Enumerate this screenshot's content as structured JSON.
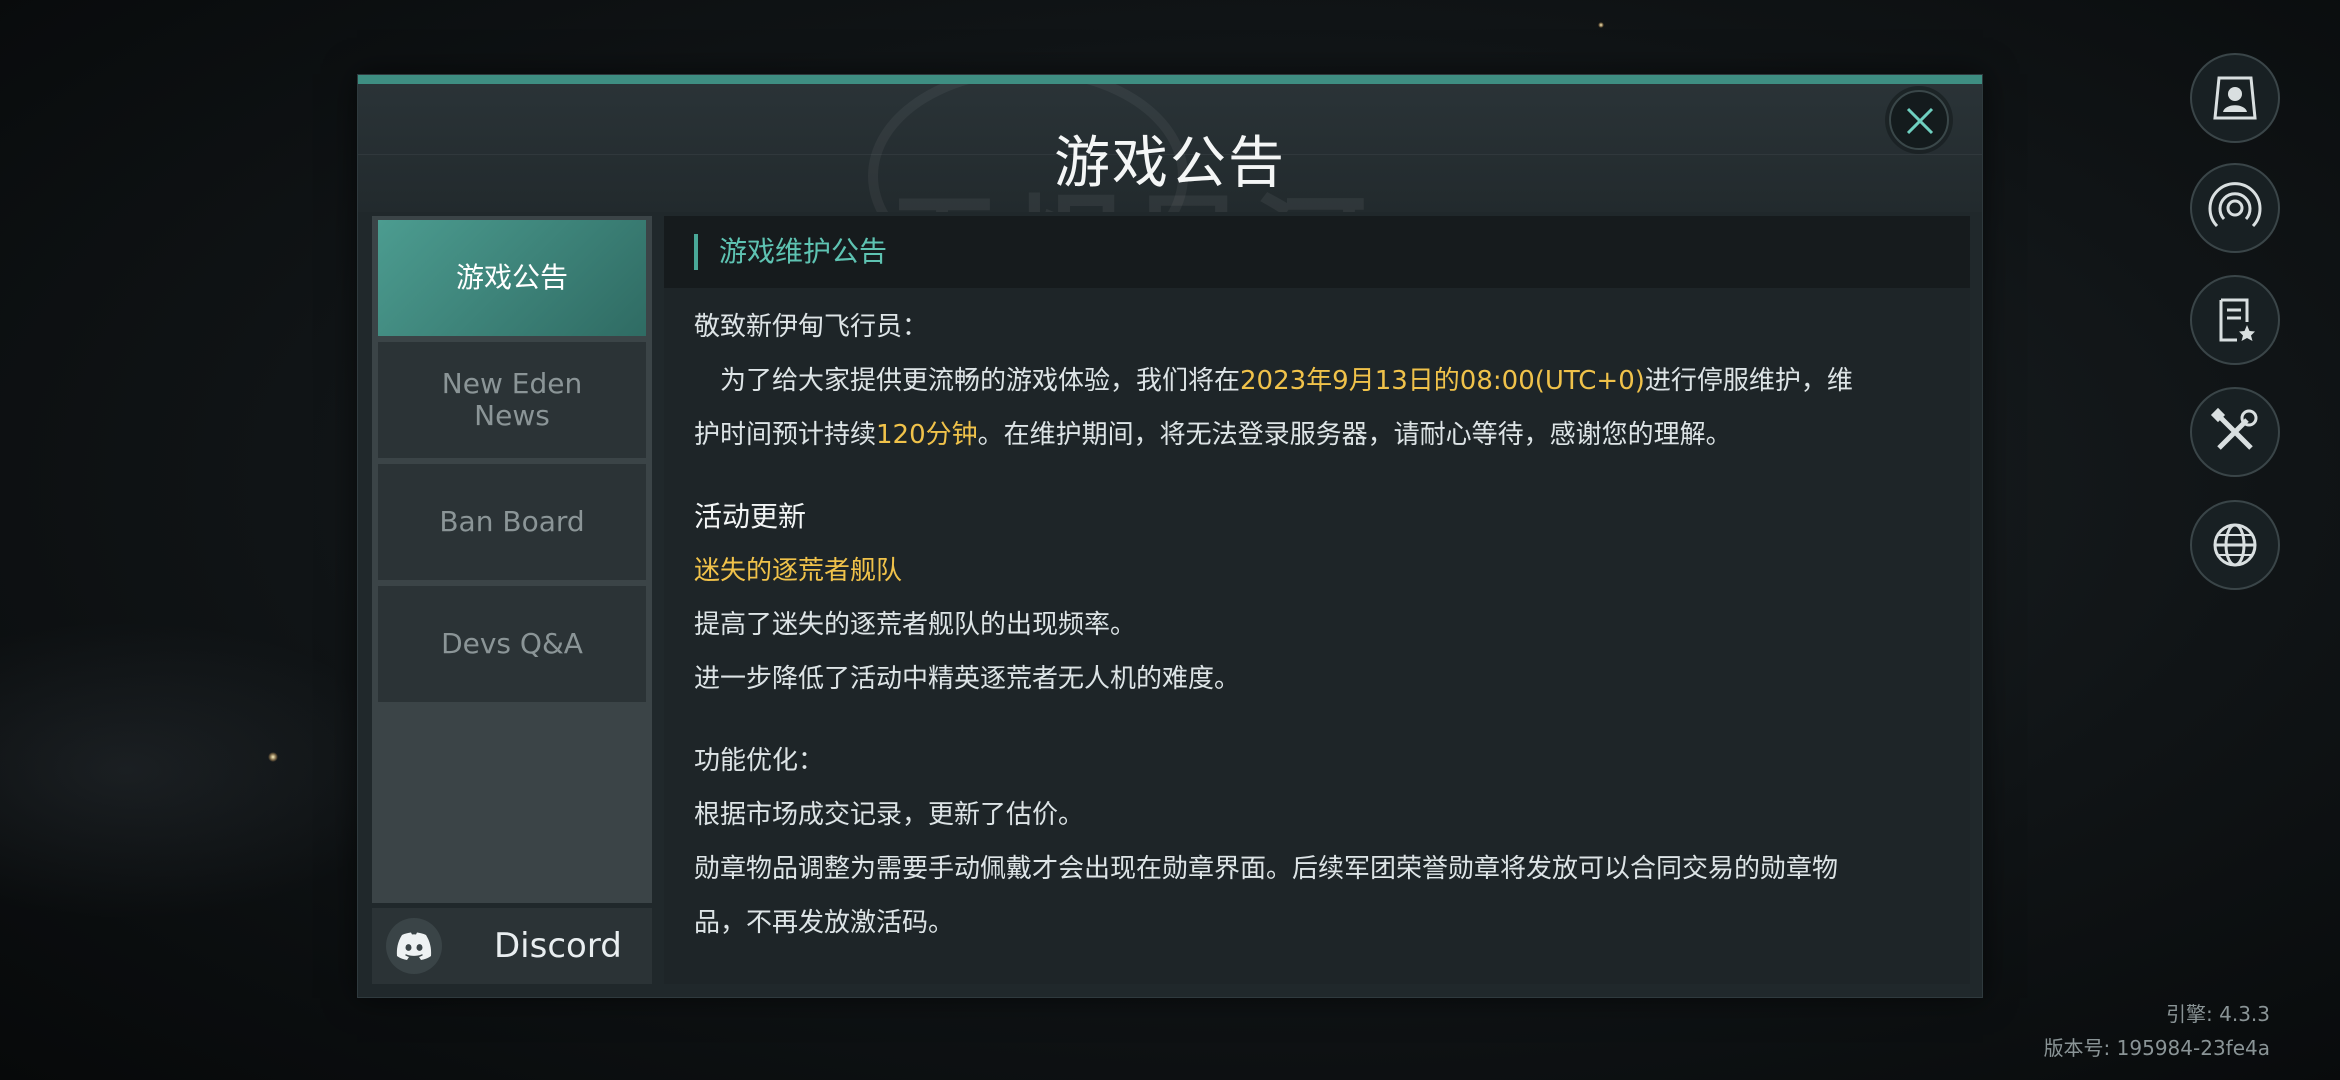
{
  "dialog": {
    "title": "游戏公告",
    "watermark": "无烬星河",
    "close_icon": "close-icon"
  },
  "sidebar": {
    "tabs": [
      {
        "label": "游戏公告",
        "active": true
      },
      {
        "label": "New Eden\nNews",
        "active": false
      },
      {
        "label": "Ban Board",
        "active": false
      },
      {
        "label": "Devs Q&A",
        "active": false
      }
    ],
    "discord": {
      "label": "Discord",
      "icon": "discord-icon"
    }
  },
  "content": {
    "header": "游戏维护公告",
    "greeting": "敬致新伊甸飞行员：",
    "para1_a": "为了给大家提供更流畅的游戏体验，我们将在",
    "para1_date": "2023年9月13日的08:00(UTC+0)",
    "para1_b": "进行停服维护，维",
    "para1_c": "护时间预计持续",
    "para1_duration": "120分钟",
    "para1_d": "。在维护期间，将无法登录服务器，请耐心等待，感谢您的理解。",
    "section1_title": "活动更新",
    "section1_sub": "迷失的逐荒者舰队",
    "section1_line1": "提高了迷失的逐荒者舰队的出现频率。",
    "section1_line2": "进一步降低了活动中精英逐荒者无人机的难度。",
    "section2_title": "功能优化：",
    "section2_line1": "根据市场成交记录，更新了估价。",
    "section2_line2": "勋章物品调整为需要手动佩戴才会出现在勋章界面。后续军团荣誉勋章将发放可以合同交易的勋章物",
    "section2_line3": "品，不再发放激活码。"
  },
  "rail": {
    "icons": [
      "profile-icon",
      "signal-icon",
      "notice-icon",
      "settings-tools-icon",
      "globe-icon"
    ]
  },
  "footer": {
    "engine": "引擎: 4.3.3",
    "version": "版本号: 195984-23fe4a"
  },
  "colors": {
    "accent": "#4aa898",
    "highlight": "#f0c24a",
    "active_tab": "#3e8e82"
  }
}
